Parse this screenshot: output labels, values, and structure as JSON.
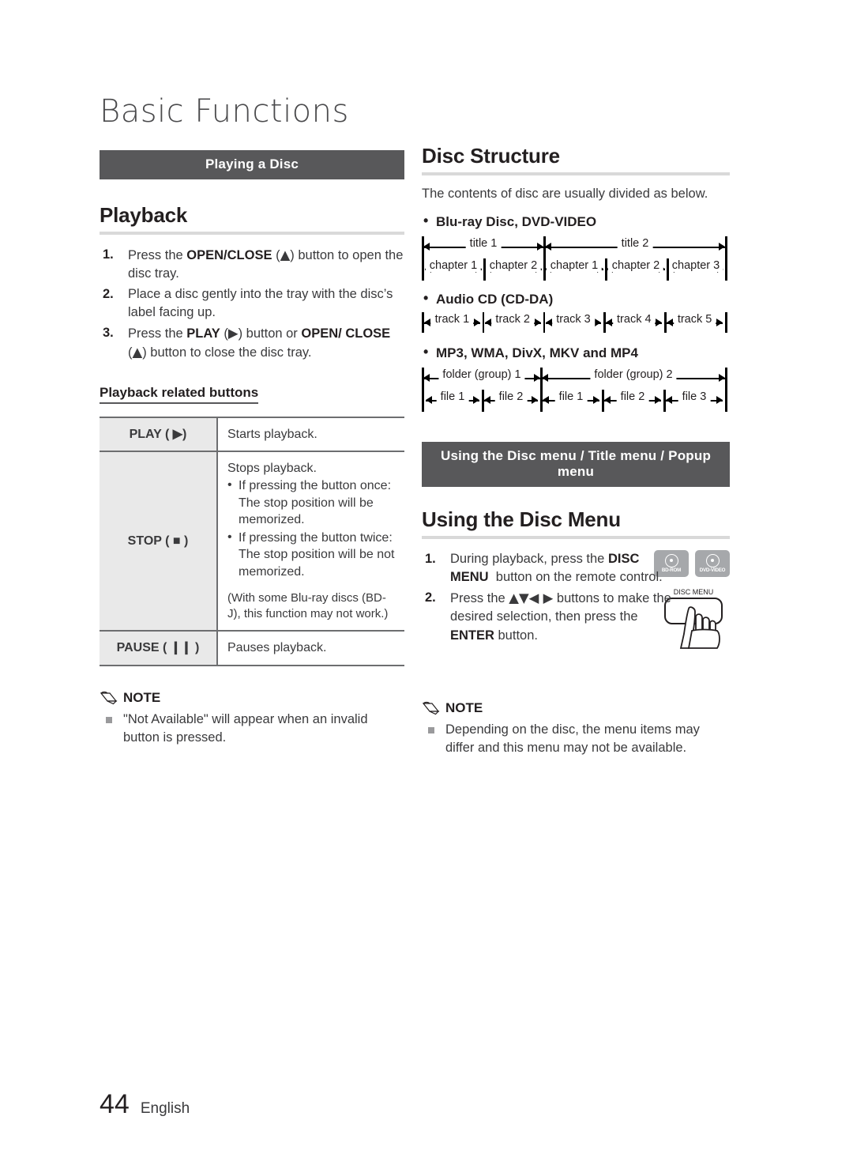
{
  "chapter": {
    "title": "Basic Functions"
  },
  "left": {
    "banner": "Playing a Disc",
    "playback_heading": "Playback",
    "steps": [
      {
        "num": "1.",
        "html": "Press the <b>OPEN/CLOSE</b> (<span class=\"sym\">▲</span>) button to open the disc tray."
      },
      {
        "num": "2.",
        "html": "Place a disc gently into the tray with the disc’s label facing up."
      },
      {
        "num": "3.",
        "html": "Press the <b>PLAY</b> (<span class=\"sym\">▶</span>) button or <b>OPEN/ CLOSE</b> (<span class=\"sym\">▲</span>) button to close the disc tray."
      }
    ],
    "related_heading": "Playback related buttons",
    "table": {
      "rows": [
        {
          "key": "PLAY ( ▶)",
          "value_main": "Starts playback.",
          "bullets": [],
          "paren": ""
        },
        {
          "key": "STOP ( ■ )",
          "value_main": "Stops playback.",
          "bullets": [
            "If pressing the button once: The stop position will be memorized.",
            "If pressing the button twice: The stop position will be not memorized."
          ],
          "paren": "(With some Blu-ray discs (BD-J), this function may not work.)"
        },
        {
          "key": "PAUSE ( ❙❙ )",
          "value_main": "Pauses playback.",
          "bullets": [],
          "paren": ""
        }
      ]
    },
    "note": {
      "label": "NOTE",
      "items": [
        "\"Not Available\" will appear when an invalid button is pressed."
      ]
    }
  },
  "right": {
    "disc_structure_heading": "Disc Structure",
    "intro": "The contents of disc are usually divided as below.",
    "bluray_label": "Blu-ray Disc, DVD-VIDEO",
    "bluray_titles": [
      "title 1",
      "title 2"
    ],
    "bluray_chapters": [
      "chapter 1",
      "chapter 2",
      "chapter 1",
      "chapter 2",
      "chapter 3"
    ],
    "audiocd_label": "Audio CD (CD-DA)",
    "audiocd_tracks": [
      "track 1",
      "track 2",
      "track 3",
      "track 4",
      "track 5"
    ],
    "mp3_label": "MP3, WMA, DivX, MKV and MP4",
    "mp3_folders": [
      "folder (group) 1",
      "folder (group) 2"
    ],
    "mp3_files": [
      "file 1",
      "file 2",
      "file 1",
      "file 2",
      "file 3"
    ],
    "banner": "Using the Disc menu / Title menu / Popup menu",
    "disc_menu_heading": "Using the Disc Menu",
    "badges": [
      {
        "name": "BD-ROM"
      },
      {
        "name": "DVD-VIDEO"
      }
    ],
    "remote_button_label": "DISC MENU",
    "steps": [
      {
        "num": "1.",
        "html": "During playback, press the <b>DISC MENU</b>&nbsp; button on the remote control."
      },
      {
        "num": "2.",
        "html": "Press the <span class=\"sym\">▲▼◀ ▶</span> buttons to make the desired selection, then press the <b>ENTER</b> button."
      }
    ],
    "note": {
      "label": "NOTE",
      "items": [
        "Depending on the disc, the menu items may differ and this menu may not be available."
      ]
    }
  },
  "footer": {
    "page": "44",
    "language": "English"
  }
}
